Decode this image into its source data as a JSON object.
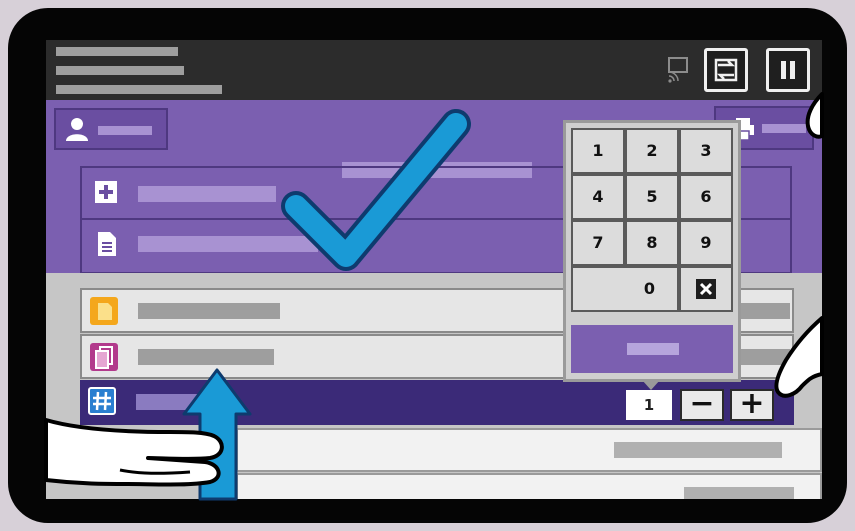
{
  "keypad": {
    "keys": [
      "1",
      "2",
      "3",
      "4",
      "5",
      "6",
      "7",
      "8",
      "9",
      "0"
    ],
    "backspace_icon": "backspace-x-icon"
  },
  "quantity": {
    "value": "1",
    "decrement_label": "−",
    "increment_label": "+"
  },
  "icons": {
    "user": "user-icon",
    "add": "plus-icon",
    "document": "document-icon",
    "print": "printer-icon",
    "screen_mirror": "screen-cast-icon",
    "interrupt": "interrupt-icon",
    "pause": "pause-icon",
    "row1": "paper-supply-icon",
    "row2": "sides-icon",
    "row3": "quantity-hash-icon",
    "checkmark": "checkmark-icon",
    "arrow": "arrow-up-icon",
    "hand": "hand-pointer-icon"
  },
  "colors": {
    "header_purple": "#7b5fb0",
    "selected_row": "#3b2a78",
    "check_blue": "#1a9ad6",
    "bezel": "#050505"
  }
}
